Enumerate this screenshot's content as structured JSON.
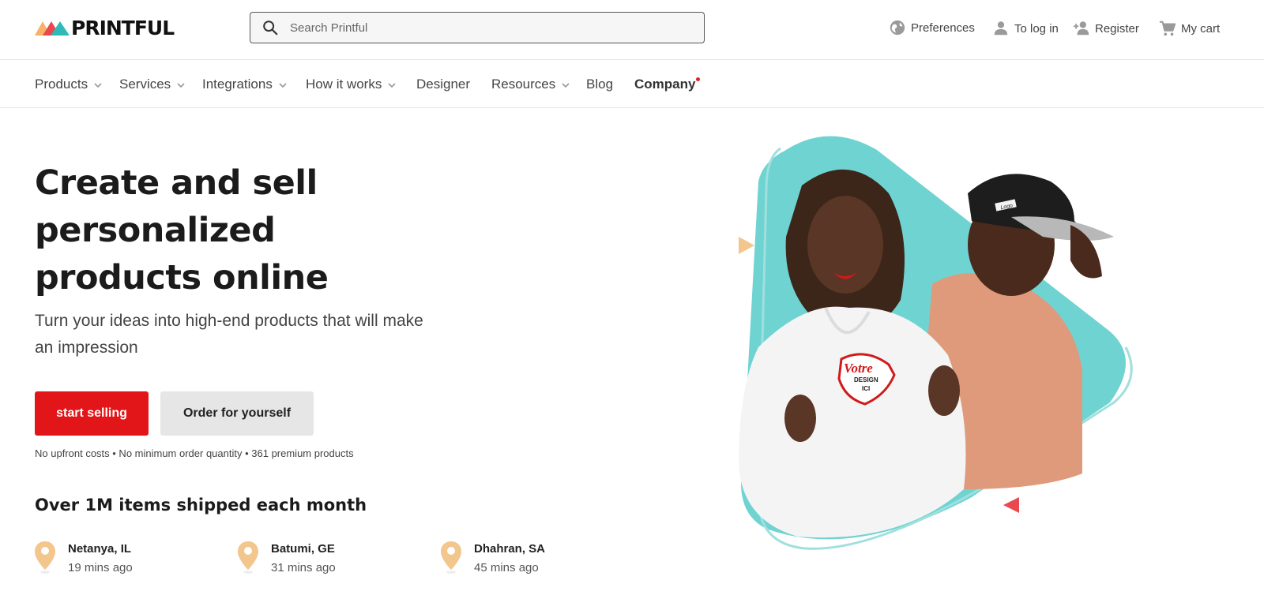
{
  "brand": {
    "name": "PRINTFUL",
    "logo_colors": [
      "#f7b267",
      "#e8484e",
      "#5cc8c8"
    ]
  },
  "search": {
    "placeholder": "Search Printful"
  },
  "utility": {
    "preferences": "Preferences",
    "login": "To log in",
    "register": "Register",
    "cart": "My cart"
  },
  "nav": {
    "products": "Products",
    "services": "Services",
    "integrations": "Integrations",
    "how_it_works": "How it works",
    "designer": "Designer",
    "resources": "Resources",
    "blog": "Blog",
    "company": "Company"
  },
  "hero": {
    "title": "Create and sell personalized products online",
    "subtitle": "Turn your ideas into high-end products that will make an impression",
    "primary_button": "start selling",
    "secondary_button": "Order for yourself",
    "fineprint": "No upfront costs • No minimum order quantity • 361 premium products",
    "image_text": {
      "hoodie_line1": "Votre",
      "hoodie_line2": "DESIGN",
      "hoodie_line3": "ICI",
      "cap_text": "Logo"
    }
  },
  "shipped": {
    "title": "Over 1M items shipped each month",
    "locations": [
      {
        "city": "Netanya, IL",
        "time": "19 mins ago"
      },
      {
        "city": "Batumi, GE",
        "time": "31 mins ago"
      },
      {
        "city": "Dhahran, SA",
        "time": "45 mins ago"
      }
    ]
  },
  "colors": {
    "accent_red": "#e21518",
    "teal": "#6fd3d2",
    "pin": "#f2c68c"
  }
}
